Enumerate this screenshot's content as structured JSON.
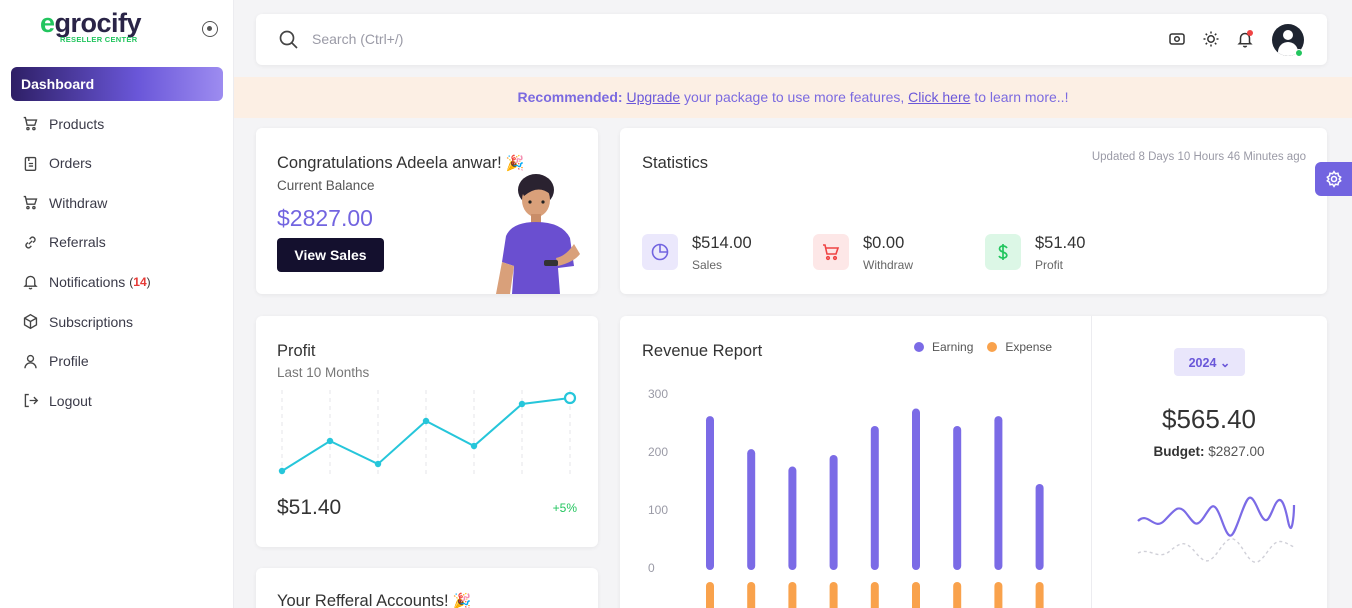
{
  "brand": {
    "logo_e": "e",
    "logo_rest": "grocify",
    "tagline": "RESELLER CENTER"
  },
  "nav": {
    "items": [
      {
        "label": "Dashboard"
      },
      {
        "label": "Products"
      },
      {
        "label": "Orders"
      },
      {
        "label": "Withdraw"
      },
      {
        "label": "Referrals"
      },
      {
        "label": "Notifications",
        "badge": "14"
      },
      {
        "label": "Subscriptions"
      },
      {
        "label": "Profile"
      },
      {
        "label": "Logout"
      }
    ]
  },
  "search": {
    "placeholder": "Search (Ctrl+/)"
  },
  "banner": {
    "prefix": "Recommended:",
    "link1": "Upgrade",
    "middle": "your package to use more features,",
    "link2": "Click here",
    "suffix": "to learn more..!"
  },
  "congrats": {
    "title": "Congratulations Adeela anwar!",
    "subtitle": "Current Balance",
    "amount": "$2827.00",
    "button": "View Sales"
  },
  "statistics": {
    "title": "Statistics",
    "updated": "Updated 8 Days 10 Hours 46 Minutes ago",
    "items": [
      {
        "value": "$514.00",
        "label": "Sales",
        "icon": "pie-chart-icon",
        "color": "#7264e0",
        "bg": "#ebe8fc"
      },
      {
        "value": "$0.00",
        "label": "Withdraw",
        "icon": "cart-icon",
        "color": "#ef4444",
        "bg": "#fde7e7"
      },
      {
        "value": "$51.40",
        "label": "Profit",
        "icon": "dollar-icon",
        "color": "#22c55e",
        "bg": "#dcf7e6"
      }
    ]
  },
  "profit": {
    "title": "Profit",
    "subtitle": "Last 10 Months",
    "amount": "$51.40",
    "change": "+5%"
  },
  "referral": {
    "title": "Your Refferal Accounts!"
  },
  "revenue": {
    "title": "Revenue Report",
    "legend_earning": "Earning",
    "legend_expense": "Expense",
    "year": "2024",
    "amount": "$565.40",
    "budget_label": "Budget:",
    "budget_value": "$2827.00"
  },
  "colors": {
    "accent": "#7264e0",
    "earning": "#7b6be6",
    "expense": "#f9a24c",
    "success": "#22c55e",
    "danger": "#ef4444"
  },
  "chart_data": [
    {
      "type": "line",
      "title": "Profit",
      "x": [
        1,
        2,
        3,
        4,
        5,
        6,
        7
      ],
      "values": [
        5,
        35,
        12,
        55,
        30,
        72,
        78
      ]
    },
    {
      "type": "bar",
      "title": "Revenue Report",
      "categories": [
        "",
        "",
        "",
        "",
        "",
        "",
        "",
        "",
        ""
      ],
      "series": [
        {
          "name": "Earning",
          "values": [
            255,
            198,
            168,
            188,
            238,
            268,
            238,
            255,
            138
          ]
        },
        {
          "name": "Expense",
          "values": [
            -40,
            -40,
            -40,
            -40,
            -40,
            -40,
            -40,
            -40,
            -40
          ]
        }
      ],
      "yticks": [
        "300",
        "200",
        "100",
        "0"
      ],
      "ylim": [
        -60,
        300
      ]
    }
  ]
}
